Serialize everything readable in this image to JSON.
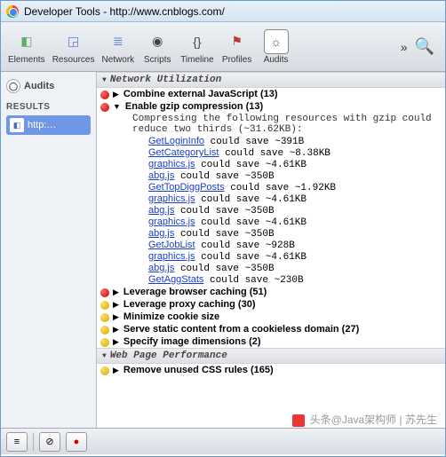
{
  "window": {
    "title": "Developer Tools - http://www.cnblogs.com/"
  },
  "toolbar": {
    "tabs": [
      {
        "label": "Elements",
        "icon": "◧",
        "color": "#5fb05f"
      },
      {
        "label": "Resources",
        "icon": "◲",
        "color": "#5b7fd1"
      },
      {
        "label": "Network",
        "icon": "≣",
        "color": "#5b7fd1"
      },
      {
        "label": "Scripts",
        "icon": "◉",
        "color": "#444"
      },
      {
        "label": "Timeline",
        "icon": "{}",
        "color": "#444"
      },
      {
        "label": "Profiles",
        "icon": "⚑",
        "color": "#c0392b"
      },
      {
        "label": "Audits",
        "icon": "☼",
        "color": "#555"
      }
    ],
    "active_index": 6,
    "more": "»"
  },
  "sidebar": {
    "header": "Audits",
    "results_label": "RESULTS",
    "items": [
      {
        "label": "http:…"
      }
    ]
  },
  "sections": [
    {
      "title": "Network Utilization",
      "rules": [
        {
          "severity": "red",
          "expanded": false,
          "label": "Combine external JavaScript",
          "count": 13
        },
        {
          "severity": "red",
          "expanded": true,
          "label": "Enable gzip compression",
          "count": 13,
          "detail": "Compressing the following resources with gzip could reduce two thirds (~31.62KB):",
          "items": [
            {
              "name": "GetLoginInfo",
              "save": "~391B"
            },
            {
              "name": "GetCategoryList",
              "save": "~8.38KB"
            },
            {
              "name": "graphics.js",
              "save": "~4.61KB"
            },
            {
              "name": "abg.js",
              "save": "~350B"
            },
            {
              "name": "GetTopDiggPosts",
              "save": "~1.92KB"
            },
            {
              "name": "graphics.js",
              "save": "~4.61KB"
            },
            {
              "name": "abg.js",
              "save": "~350B"
            },
            {
              "name": "graphics.js",
              "save": "~4.61KB"
            },
            {
              "name": "abg.js",
              "save": "~350B"
            },
            {
              "name": "GetJobList",
              "save": "~928B"
            },
            {
              "name": "graphics.js",
              "save": "~4.61KB"
            },
            {
              "name": "abg.js",
              "save": "~350B"
            },
            {
              "name": "GetAggStats",
              "save": "~230B"
            }
          ]
        },
        {
          "severity": "red",
          "expanded": false,
          "label": "Leverage browser caching",
          "count": 51
        },
        {
          "severity": "yellow",
          "expanded": false,
          "label": "Leverage proxy caching",
          "count": 30
        },
        {
          "severity": "yellow",
          "expanded": false,
          "label": "Minimize cookie size",
          "count": null
        },
        {
          "severity": "yellow",
          "expanded": false,
          "label": "Serve static content from a cookieless domain",
          "count": 27
        },
        {
          "severity": "yellow",
          "expanded": false,
          "label": "Specify image dimensions",
          "count": 2
        }
      ]
    },
    {
      "title": "Web Page Performance",
      "rules": [
        {
          "severity": "yellow",
          "expanded": false,
          "label": "Remove unused CSS rules",
          "count": 165
        }
      ]
    }
  ],
  "strings": {
    "could_save": " could save "
  },
  "watermark": {
    "text1": "头条@Java架构师",
    "text2": "苏先生"
  }
}
